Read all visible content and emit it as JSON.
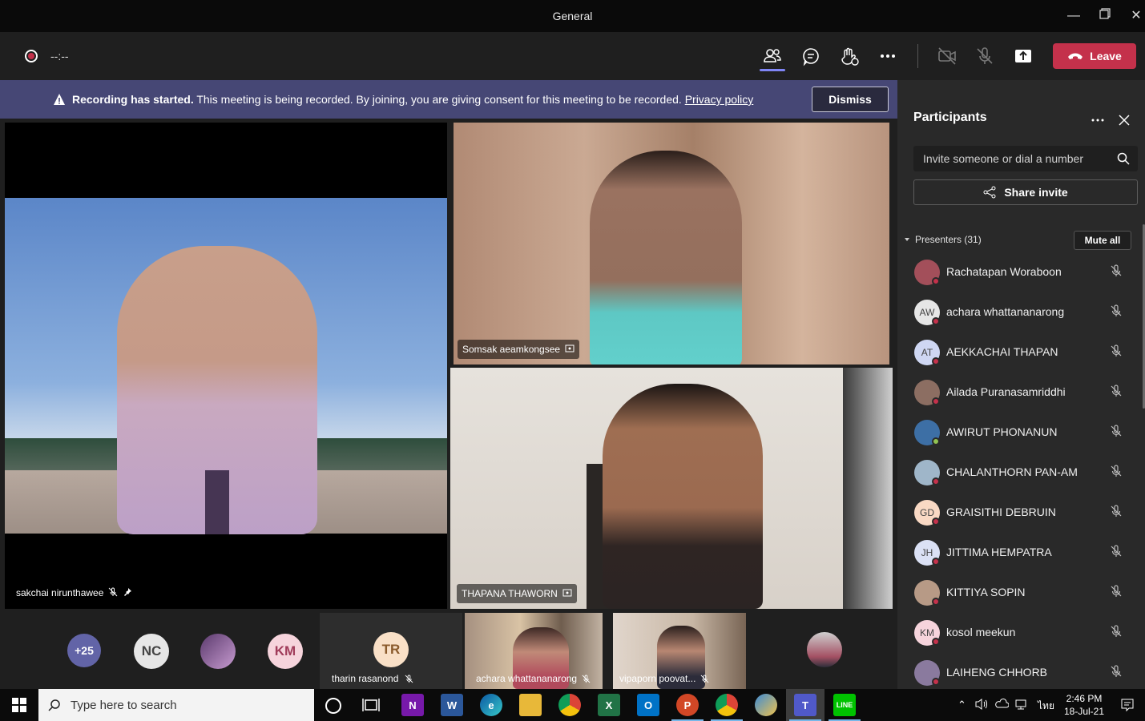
{
  "window": {
    "title": "General"
  },
  "toolbar": {
    "timer": "--:--",
    "leave_label": "Leave"
  },
  "banner": {
    "bold": "Recording has started.",
    "message": "This meeting is being recorded. By joining, you are giving consent for this meeting to be recorded.",
    "link": "Privacy policy",
    "dismiss_label": "Dismiss"
  },
  "videos": {
    "main": {
      "name": "sakchai nirunthawee"
    },
    "top_right": {
      "name": "Somsak aeamkongsee"
    },
    "bottom_right": {
      "name": "THAPANA THAWORN"
    }
  },
  "strip": {
    "overflow": "+25",
    "avatars": [
      {
        "initials": "NC"
      },
      {
        "initials": "KM"
      }
    ],
    "tiles": [
      {
        "initials": "TR",
        "name": "tharin rasanond"
      },
      {
        "name": "achara whattananarong"
      },
      {
        "name": "vipaporn poovat..."
      }
    ]
  },
  "participants": {
    "title": "Participants",
    "search_placeholder": "Invite someone or dial a number",
    "share_label": "Share invite",
    "section_label": "Presenters (31)",
    "mute_all_label": "Mute all",
    "people": [
      {
        "name": "Rachatapan Woraboon",
        "initials": "",
        "status": "red",
        "avatar_color": "#a34f5a"
      },
      {
        "name": "achara whattananarong",
        "initials": "AW",
        "status": "red",
        "avatar_color": "#e6e6e6"
      },
      {
        "name": "AEKKACHAI THAPAN",
        "initials": "AT",
        "status": "red",
        "avatar_color": "#cfd7f3"
      },
      {
        "name": "Ailada Puranasamriddhi",
        "initials": "",
        "status": "red",
        "avatar_color": "#8c6e62"
      },
      {
        "name": "AWIRUT PHONANUN",
        "initials": "",
        "status": "green",
        "avatar_color": "#3d6fa5"
      },
      {
        "name": "CHALANTHORN PAN-AM",
        "initials": "",
        "status": "red",
        "avatar_color": "#9fb6c9"
      },
      {
        "name": "GRAISITHI DEBRUIN",
        "initials": "GD",
        "status": "red",
        "avatar_color": "#f9d9c4"
      },
      {
        "name": "JITTIMA HEMPATRA",
        "initials": "JH",
        "status": "red",
        "avatar_color": "#dbe1f5"
      },
      {
        "name": "KITTIYA SOPIN",
        "initials": "",
        "status": "red",
        "avatar_color": "#b79a86"
      },
      {
        "name": "kosol meekun",
        "initials": "KM",
        "status": "red",
        "avatar_color": "#f6d4dc"
      },
      {
        "name": "LAIHENG CHHORB",
        "initials": "",
        "status": "red",
        "avatar_color": "#8a7a9e"
      }
    ]
  },
  "taskbar": {
    "search_placeholder": "Type here to search",
    "time": "2:46 PM",
    "date": "18-Jul-21",
    "lang": "ไทย"
  },
  "colors": {
    "leave": "#c4314b",
    "banner": "#464775",
    "accent": "#7f85f5"
  }
}
